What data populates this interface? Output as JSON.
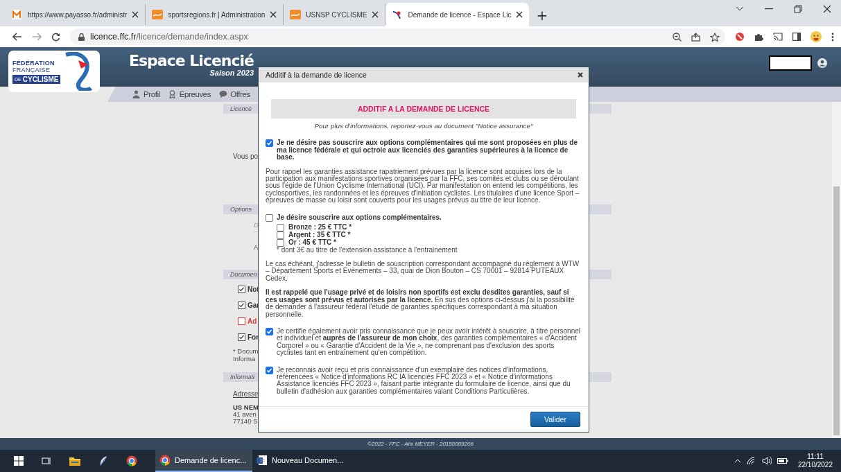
{
  "browser": {
    "tabs": [
      {
        "title": "https://www.payasso.fr/administr",
        "selected": false
      },
      {
        "title": "sportsregions.fr | Administration",
        "selected": false
      },
      {
        "title": "USNSP CYCLISME",
        "selected": false
      },
      {
        "title": "Demande de licence - Espace Lic",
        "selected": true
      }
    ],
    "new_tab": "+",
    "url_host": "licence.ffc.fr",
    "url_path": "/licence/demande/index.aspx"
  },
  "site": {
    "logo": {
      "line_1": "FÉDÉRATION",
      "line_2": "FRANÇAISE",
      "small": "DE",
      "line_3": "CYCLISME"
    },
    "title": "Espace Licencié",
    "subtitle": "Saison 2023",
    "nav": [
      {
        "label": "Profil"
      },
      {
        "label": "Epreuves"
      },
      {
        "label": "Offres"
      }
    ]
  },
  "background_page": {
    "section_1": "Licence",
    "intro": "Vous po",
    "section_2": "Options",
    "field_1": "D",
    "field_2": "A",
    "section_3": "Documen",
    "documents": [
      {
        "label": "Not",
        "checked": true
      },
      {
        "label": "Gar",
        "checked": true
      },
      {
        "label": "Ad",
        "checked": false
      },
      {
        "label": "For",
        "checked": true
      }
    ],
    "note_1": "* Docum",
    "note_2": "Informa",
    "section_4": "Informati",
    "address_title": "Adresse",
    "address_name": "US NEM",
    "address_1": "41 aven",
    "address_2": "77140 S"
  },
  "modal": {
    "title": "Additif à la demande de licence",
    "banner": "ADDITIF A LA DEMANDE DE LICENCE",
    "note": "Pour plus d'informations, reportez-vous au document \"Notice assurance\"",
    "blocks": [
      {
        "kind": "check",
        "checked": true,
        "bold": true,
        "text": "Je ne désire pas souscrire aux options complémentaires qui me sont proposées en plus de ma licence fédérale et qui octroie aux licenciés des garanties supérieures à la licence de base."
      },
      {
        "kind": "para",
        "text": "Pour rappel les garanties assistance rapatriement prévues par la licence sont acquises lors de la participation aux manifestations sportives organisées par la FFC, ses comités et clubs ou se déroulant sous l'égide de l'Union Cyclisme International (UCI). Par manifestation on entend les compétitions, les cyclosportives, les randonnées et les épreuves d'initiation cyclistes. Les titulaires d'une licence Sport – épreuves de masse ou loisir sont couverts pour les usages prévus au titre de leur licence."
      },
      {
        "kind": "check",
        "checked": false,
        "bold": true,
        "text": "Je désire souscrire aux options complémentaires.",
        "options": [
          {
            "label": "Bronze : 25 € TTC *",
            "checked": false
          },
          {
            "label": "Argent : 35 € TTC *",
            "checked": false
          },
          {
            "label": "Or : 45 € TTC *",
            "checked": false
          }
        ],
        "footnote": "* dont 3€ au titre de l'extension assistance à l'entrainement"
      },
      {
        "kind": "para",
        "text": "Le cas échéant, j'adresse le bulletin de souscription correspondant accompagné du règlement à WTW – Département Sports et Evènements – 33, quai de Dion Bouton – CS 70001 – 92814 PUTEAUX Cedex."
      },
      {
        "kind": "para",
        "text": "**Il est rappelé que l'usage privé et de loisirs non sportifs est exclu desdites garanties, sauf si ces usages sont prévus et autorisés par la licence.** En sus des options ci-dessus j'ai la possibilité de demander à l'assureur fédéral l'étude de garanties spécifiques correspondant à ma situation personnelle."
      },
      {
        "kind": "check",
        "checked": true,
        "bold": false,
        "text": "Je certifie également avoir pris connaissance que je peux avoir intérêt à souscrire, à titre personnel et individuel et **auprès de l'assureur de mon choix**, des garanties complémentaires « d'Accident Corporel » ou « Garantie d'Accident de la Vie », ne comprenant pas d'exclusion des sports cyclistes tant en entraînement qu'en compétition."
      },
      {
        "kind": "check",
        "checked": true,
        "bold": false,
        "text": "Je reconnais avoir reçu et pris connaissance d'un exemplaire des notices d'informations, référencées « Notice d'informations RC IA licenciés FFC 2023 » et « Notice d'informations Assistance licenciés FFC 2023 », faisant partie intégrante du formulaire de licence, ainsi que du bulletin d'adhésion aux garanties complémentaires valant Conditions Particulières."
      }
    ],
    "button": "Valider"
  },
  "footer": "©2022 - FFC - Alix MEYER - 20150009206",
  "taskbar": {
    "apps": [
      {
        "label": "Demande de licenc...",
        "selected": true
      },
      {
        "label": "Nouveau Documen...",
        "selected": false
      }
    ],
    "time": "11:11",
    "date": "22/10/2022"
  }
}
